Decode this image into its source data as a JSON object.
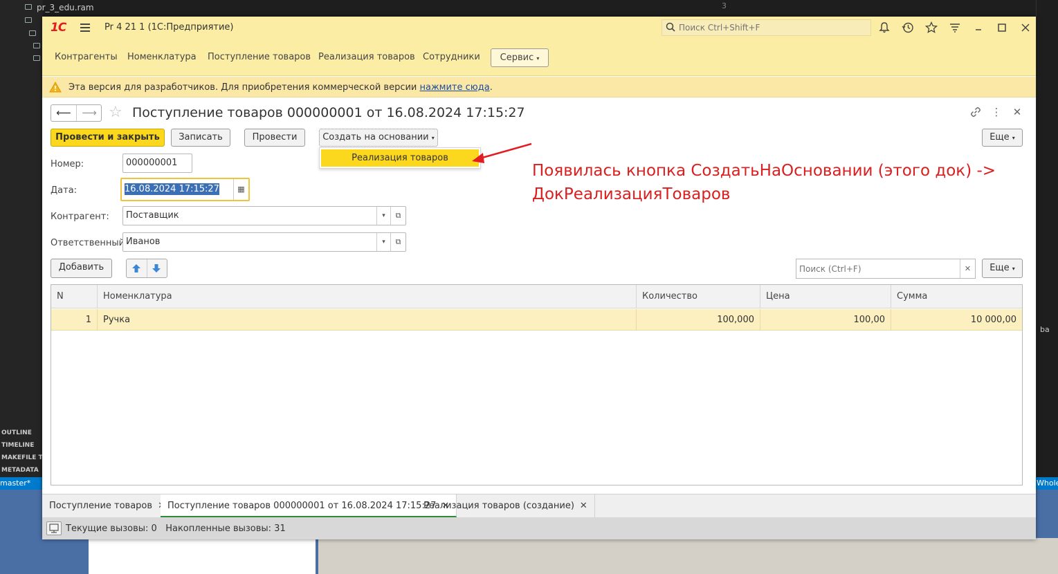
{
  "background": {
    "file_name": "pr_3_edu.ram",
    "line_number": "3",
    "sections": [
      "OUTLINE",
      "TIMELINE",
      "MAKEFILE TAS",
      "METADATA"
    ],
    "status_left": "master*",
    "status_right": "Whole",
    "strip_item": "ba"
  },
  "window": {
    "logo": "1С",
    "title": "Pr 4 21 1 (1С:Предприятие)",
    "search_placeholder": "Поиск Ctrl+Shift+F"
  },
  "menu": {
    "items": [
      "Контрагенты",
      "Номенклатура",
      "Поступление товаров",
      "Реализация товаров",
      "Сотрудники"
    ],
    "service": "Сервис"
  },
  "warning": {
    "text": "Эта версия для разработчиков. Для приобретения коммерческой версии ",
    "link": "нажмите сюда",
    "tail": "."
  },
  "document": {
    "title": "Поступление товаров 000000001 от 16.08.2024 17:15:27",
    "buttons": {
      "post_close": "Провести и закрыть",
      "save": "Записать",
      "post": "Провести",
      "create_based": "Создать на основании",
      "more": "Еще"
    },
    "dropdown_item": "Реализация товаров",
    "fields": {
      "number_label": "Номер:",
      "number_value": "000000001",
      "date_label": "Дата:",
      "date_value": "16.08.2024 17:15:27",
      "contractor_label": "Контрагент:",
      "contractor_value": "Поставщик",
      "responsible_label": "Ответственный:",
      "responsible_value": "Иванов"
    },
    "table_toolbar": {
      "add": "Добавить",
      "search_placeholder": "Поиск (Ctrl+F)",
      "more": "Еще"
    },
    "table": {
      "columns": [
        "N",
        "Номенклатура",
        "Количество",
        "Цена",
        "Сумма"
      ],
      "rows": [
        {
          "n": "1",
          "item": "Ручка",
          "qty": "100,000",
          "price": "100,00",
          "sum": "10 000,00"
        }
      ]
    }
  },
  "tabs": [
    {
      "label": "Поступление товаров",
      "active": false
    },
    {
      "label": "Поступление товаров 000000001 от 16.08.2024 17:15:27",
      "active": true
    },
    {
      "label": "Реализация товаров (создание)",
      "active": false
    }
  ],
  "status": {
    "text": "Текущие вызовы: 0   Накопленные вызовы: 31"
  },
  "annotation": {
    "line1": "Появилась кнопка СоздатьНаОсновании (этого док) ->",
    "line2": "ДокРеализацияТоваров",
    "color": "#d92020"
  },
  "colors": {
    "accent_yellow": "#fbd71d",
    "header_bg": "#fbeda4",
    "selected_row": "#fcefc0",
    "active_tab_underline": "#2e8b3d"
  }
}
